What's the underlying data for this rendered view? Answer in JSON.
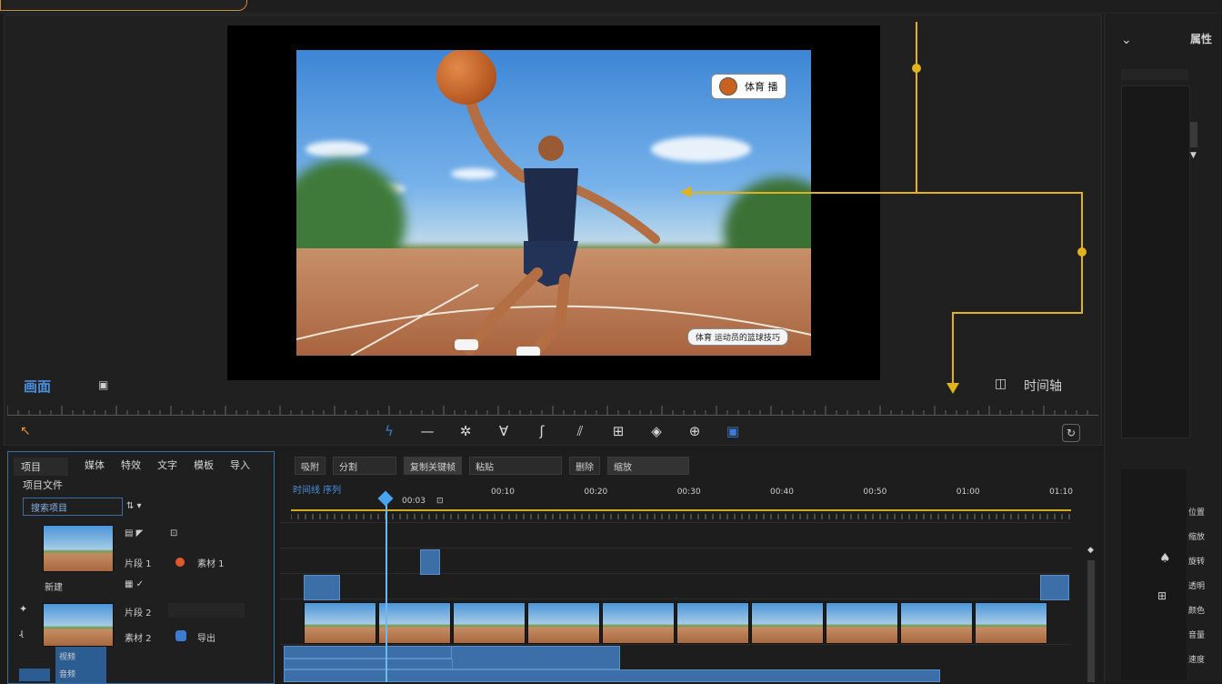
{
  "preview": {
    "badge_label": "体育 播",
    "caption": "体育 运动员的篮球技巧",
    "left_label": "画面",
    "right_label": "时间轴"
  },
  "toolbar": {
    "tools": [
      "razor-icon",
      "line-icon",
      "effects-icon",
      "text-icon",
      "transition-icon",
      "marker-icon",
      "crop-icon",
      "audio-icon",
      "color-icon",
      "export-icon"
    ]
  },
  "left_panel": {
    "tabs": [
      "项目",
      "媒体",
      "特效",
      "文字",
      "模板",
      "导入"
    ],
    "title": "项目文件",
    "search_label": "搜索项目",
    "items": [
      {
        "name": "片段 1",
        "sub": "素材 1"
      },
      {
        "name": "片段 2",
        "sub": "素材 2"
      }
    ],
    "extra_labels": [
      "新建",
      "导出"
    ],
    "dropdown": [
      "视频",
      "音频"
    ]
  },
  "timeline": {
    "buttons": [
      "吸附",
      "分割",
      "复制关键帧",
      "粘贴",
      "删除",
      "缩放"
    ],
    "title": "时间线 序列",
    "playhead": "00:03",
    "ticks": [
      "00:10",
      "00:20",
      "00:30",
      "00:40",
      "00:50",
      "01:00",
      "01:10"
    ]
  },
  "right_panel": {
    "title": "属性",
    "labels": [
      "位置",
      "缩放",
      "旋转",
      "透明",
      "颜色",
      "音量",
      "速度"
    ]
  },
  "colors": {
    "accent": "#3b7bd4",
    "yellow": "#e2b21b",
    "orange": "#c98a3a"
  }
}
